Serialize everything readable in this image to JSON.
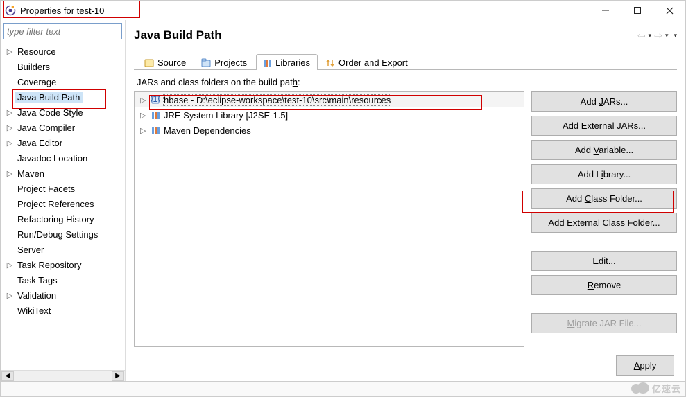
{
  "window": {
    "title": "Properties for test-10"
  },
  "filter": {
    "placeholder": "type filter text"
  },
  "tree": [
    {
      "label": "Resource",
      "expandable": true
    },
    {
      "label": "Builders",
      "expandable": false
    },
    {
      "label": "Coverage",
      "expandable": false
    },
    {
      "label": "Java Build Path",
      "expandable": false,
      "selected": true
    },
    {
      "label": "Java Code Style",
      "expandable": true
    },
    {
      "label": "Java Compiler",
      "expandable": true
    },
    {
      "label": "Java Editor",
      "expandable": true
    },
    {
      "label": "Javadoc Location",
      "expandable": false
    },
    {
      "label": "Maven",
      "expandable": true
    },
    {
      "label": "Project Facets",
      "expandable": false
    },
    {
      "label": "Project References",
      "expandable": false
    },
    {
      "label": "Refactoring History",
      "expandable": false
    },
    {
      "label": "Run/Debug Settings",
      "expandable": false
    },
    {
      "label": "Server",
      "expandable": false
    },
    {
      "label": "Task Repository",
      "expandable": true
    },
    {
      "label": "Task Tags",
      "expandable": false
    },
    {
      "label": "Validation",
      "expandable": true
    },
    {
      "label": "WikiText",
      "expandable": false
    }
  ],
  "page": {
    "heading": "Java Build Path",
    "tab_desc_pre": "JARs and class folders on the build pat",
    "tab_desc_u": "h",
    "tab_desc_post": ":"
  },
  "tabs": [
    {
      "label": "Source",
      "icon": "source"
    },
    {
      "label": "Projects",
      "icon": "projects"
    },
    {
      "label": "Libraries",
      "icon": "libraries",
      "active": true
    },
    {
      "label": "Order and Export",
      "icon": "order"
    }
  ],
  "libs": [
    {
      "label": "hbase - D:\\eclipse-workspace\\test-10\\src\\main\\resources",
      "icon": "jar-blue",
      "selected": true
    },
    {
      "label": "JRE System Library [J2SE-1.5]",
      "icon": "lib"
    },
    {
      "label": "Maven Dependencies",
      "icon": "lib"
    }
  ],
  "buttons": {
    "add_jars_pre": "Add ",
    "add_jars_u": "J",
    "add_jars_post": "ARs...",
    "add_ext_jars_pre": "Add E",
    "add_ext_jars_u": "x",
    "add_ext_jars_post": "ternal JARs...",
    "add_var_pre": "Add ",
    "add_var_u": "V",
    "add_var_post": "ariable...",
    "add_lib_pre": "Add L",
    "add_lib_u": "i",
    "add_lib_post": "brary...",
    "add_cf_pre": "Add ",
    "add_cf_u": "C",
    "add_cf_post": "lass Folder...",
    "add_ext_cf_pre": "Add External Class Fol",
    "add_ext_cf_u": "d",
    "add_ext_cf_post": "er...",
    "edit_u": "E",
    "edit_post": "dit...",
    "remove_u": "R",
    "remove_post": "emove",
    "migrate_u": "M",
    "migrate_post": "igrate JAR File...",
    "apply_u": "A",
    "apply_post": "pply"
  },
  "watermark": "亿速云"
}
